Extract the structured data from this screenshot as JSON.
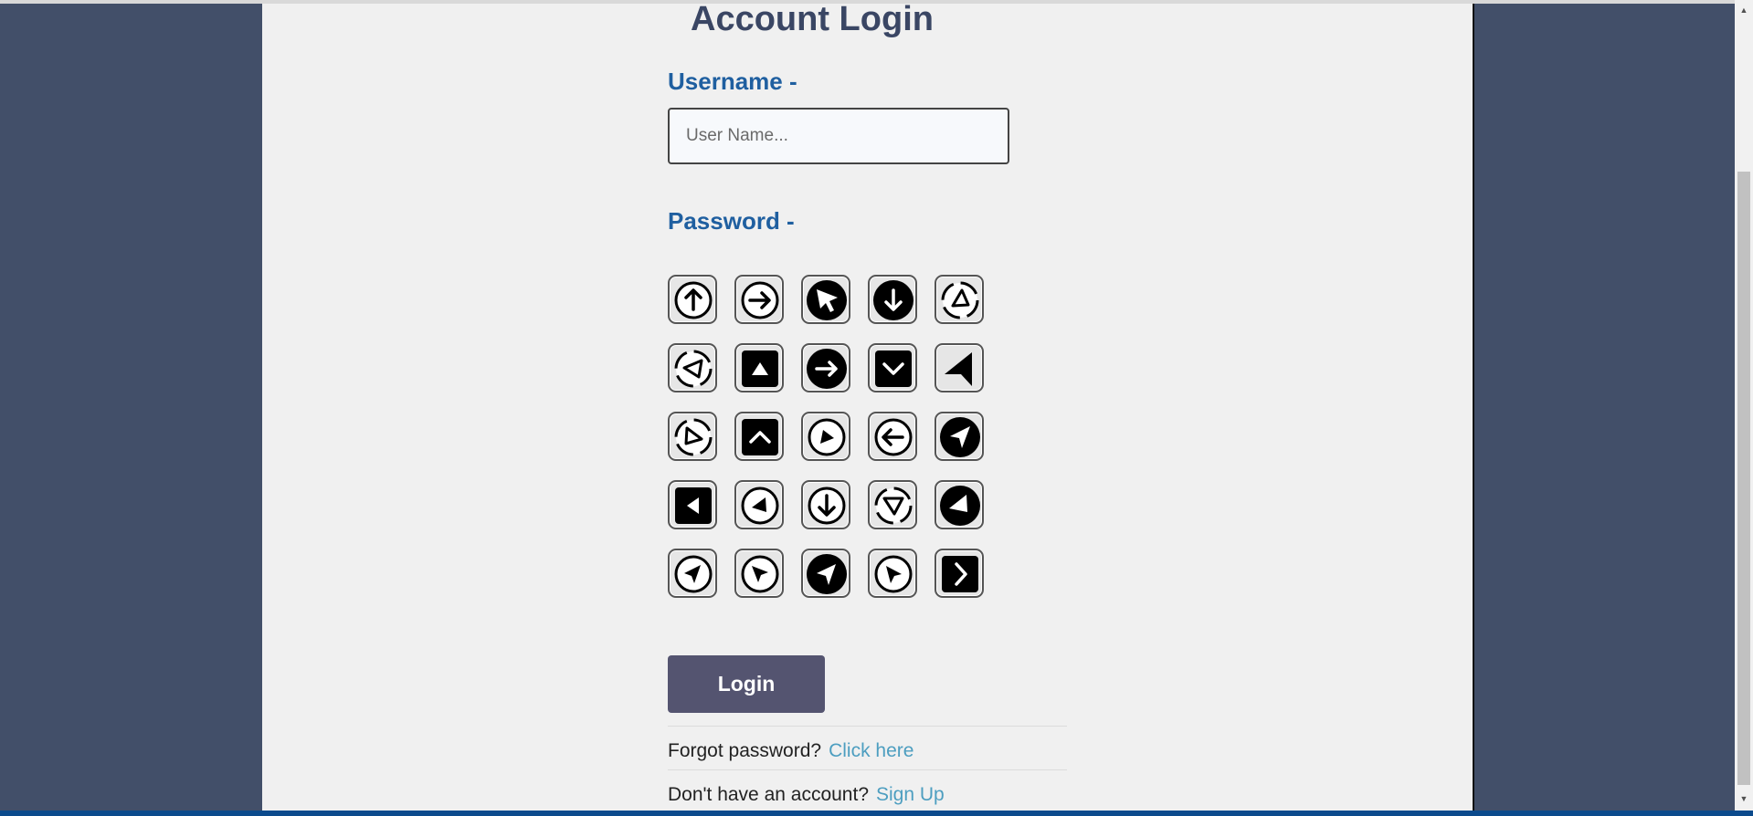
{
  "page": {
    "title": "Account Login"
  },
  "form": {
    "username_label": "Username -",
    "username_placeholder": "User Name...",
    "password_label": "Password -",
    "login_label": "Login"
  },
  "links": {
    "forgot_text": "Forgot password?",
    "forgot_link": "Click here",
    "signup_text": "Don't have an account?",
    "signup_link": "Sign Up"
  },
  "password_icons": [
    [
      "arrow-up-circle-icon",
      "arrow-right-circle-icon",
      "cursor-filled-circle-icon",
      "arrow-down-filled-circle-icon",
      "rotate-dashed-circle-icon"
    ],
    [
      "rotate-dashed-circle-icon",
      "triangle-up-square-icon",
      "arrow-right-filled-circle-icon",
      "chevron-down-square-icon",
      "navigation-filled-icon"
    ],
    [
      "rotate-dashed-circle-icon",
      "chevron-up-square-icon",
      "play-circle-icon",
      "arrow-left-circle-icon",
      "navigation-filled-circle-icon"
    ],
    [
      "triangle-left-square-icon",
      "navigation-circle-icon",
      "arrow-down-circle-icon",
      "rotate-dashed-circle-icon",
      "navigation-filled-circle-icon"
    ],
    [
      "navigation-circle-icon",
      "cursor-circle-icon",
      "navigation-filled-circle-icon",
      "cursor-circle-icon",
      "chevron-right-square-icon"
    ]
  ],
  "colors": {
    "background": "#424f69",
    "panel": "#f0f0f0",
    "title": "#3a4664",
    "label": "#1f5fa0",
    "button": "#545470",
    "link": "#4d9ec0"
  }
}
